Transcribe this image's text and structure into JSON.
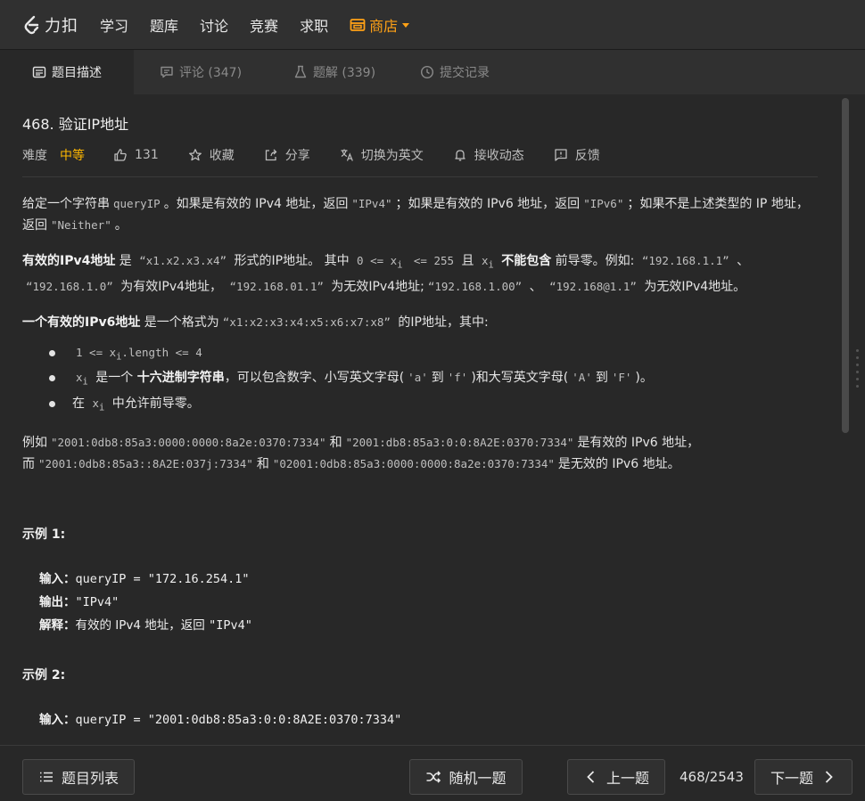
{
  "nav": {
    "logo_text": "力扣",
    "items": [
      "学习",
      "题库",
      "讨论",
      "竞赛",
      "求职"
    ],
    "store_label": "商店"
  },
  "tabs": [
    {
      "label": "题目描述"
    },
    {
      "label": "评论 (347)"
    },
    {
      "label": "题解 (339)"
    },
    {
      "label": "提交记录"
    }
  ],
  "problem": {
    "title": "468. 验证IP地址",
    "difficulty_label": "难度",
    "difficulty": "中等",
    "likes": "131",
    "favorite": "收藏",
    "share": "分享",
    "switch_lang": "切换为英文",
    "subscribe": "接收动态",
    "feedback": "反馈"
  },
  "desc": {
    "p1": {
      "a": "给定一个字符串",
      "code1": "queryIP",
      "b": "。如果是有效的 IPv4 地址，返回",
      "code2": "\"IPv4\"",
      "c": "；如果是有效的 IPv6 地址，返回",
      "code3": "\"IPv6\"",
      "d": "；如果不是上述类型的 IP 地址，返回",
      "code4": "\"Neither\"",
      "e": "。"
    },
    "p2": {
      "b1": "有效的IPv4地址",
      "a": "是",
      "code1": "“x1.x2.x3.x4”",
      "b": "形式的IP地址。 其中",
      "code2": "0 <= x",
      "sub1": "i",
      "code3": "<= 255",
      "c": "且",
      "code4": "x",
      "sub2": "i",
      "b2": "不能包含",
      "d": "前导零。例如:",
      "code5": "“192.168.1.1”",
      "e": "、",
      "code6": "“192.168.1.0”",
      "f": "为有效IPv4地址，",
      "code7": "“192.168.01.1”",
      "g": "为无效IPv4地址;",
      "code8": "“192.168.1.00”",
      "h": "、",
      "code9": "“192.168@1.1”",
      "i": "为无效IPv4地址。"
    },
    "p3": {
      "b1": "一个有效的IPv6地址",
      "a": "是一个格式为",
      "code1": "“x1:x2:x3:x4:x5:x6:x7:x8”",
      "b": "的IP地址，其中:"
    },
    "bullets": {
      "li1_code_a": "1 <= x",
      "li1_sub": "i",
      "li1_code_b": ".length <= 4",
      "li2_code": "x",
      "li2_sub": "i",
      "li2_a": "是一个",
      "li2_b": "十六进制字符串",
      "li2_c": "，可以包含数字、小写英文字母(",
      "li2_code2": "'a'",
      "li2_d": "到",
      "li2_code3": "'f'",
      "li2_e": ")和大写英文字母(",
      "li2_code4": "'A'",
      "li2_f": "到",
      "li2_code5": "'F'",
      "li2_g": ")。",
      "li3_a": "在",
      "li3_code": "x",
      "li3_sub": "i",
      "li3_b": "中允许前导零。"
    },
    "p4": {
      "a": "例如",
      "code1": "\"2001:0db8:85a3:0000:0000:8a2e:0370:7334\"",
      "b": "和",
      "code2": "\"2001:db8:85a3:0:0:8A2E:0370:7334\"",
      "c": "是有效的 IPv6 地址，而",
      "code3": "\"2001:0db8:85a3::8A2E:037j:7334\"",
      "d": "和",
      "code4": "\"02001:0db8:85a3:0000:0000:8a2e:0370:7334\"",
      "e": "是无效的 IPv6 地址。"
    }
  },
  "examples": [
    {
      "title": "示例 1:",
      "input_label": "输入：",
      "input": "queryIP = \"172.16.254.1\"",
      "output_label": "输出：",
      "output": "\"IPv4\"",
      "explain_label": "解释：",
      "explain_a": "有效的 IPv4 地址，返回 ",
      "explain_b": "\"IPv4\""
    },
    {
      "title": "示例 2:",
      "input_label": "输入：",
      "input": "queryIP = \"2001:0db8:85a3:0:0:8A2E:0370:7334\""
    }
  ],
  "footer": {
    "list_label": "题目列表",
    "random_label": "随机一题",
    "prev_label": "上一题",
    "counter": "468/2543",
    "next_label": "下一题"
  },
  "colors": {
    "accent": "#ffa116",
    "medium_difficulty": "#ffb800",
    "background": "#282828"
  }
}
